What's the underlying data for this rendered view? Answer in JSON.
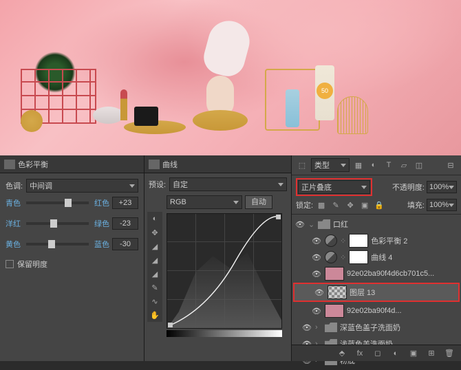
{
  "canvas": {
    "sun_label": "50"
  },
  "colorBalance": {
    "panelTitle": "色彩平衡",
    "toneLabel": "色调:",
    "toneValue": "中间调",
    "sliders": [
      {
        "left": "青色",
        "right": "红色",
        "value": "+23",
        "pos": 62
      },
      {
        "left": "洋红",
        "right": "绿色",
        "value": "-23",
        "pos": 38
      },
      {
        "left": "黄色",
        "right": "蓝色",
        "value": "-30",
        "pos": 35
      }
    ],
    "preserve": "保留明度"
  },
  "curves": {
    "panelTitle": "曲线",
    "presetLabel": "预设:",
    "presetValue": "自定",
    "channel": "RGB",
    "autoBtn": "自动"
  },
  "layers": {
    "kindLabel": "类型",
    "blendMode": "正片叠底",
    "opacityLabel": "不透明度:",
    "opacityValue": "100%",
    "lockLabel": "锁定:",
    "fillLabel": "填充:",
    "fillValue": "100%",
    "group": "口红",
    "items": [
      {
        "name": "色彩平衡 2",
        "type": "adj"
      },
      {
        "name": "曲线 4",
        "type": "adj"
      },
      {
        "name": "92e02ba90f4d6cb701c5...",
        "type": "img"
      },
      {
        "name": "图层 13",
        "type": "layer",
        "selected": true
      },
      {
        "name": "92e02ba90f4d...",
        "type": "img"
      }
    ],
    "groups": [
      {
        "name": "深蓝色盖子洗面奶"
      },
      {
        "name": "浅蓝色盖洗面奶"
      },
      {
        "name": "粉底"
      }
    ]
  }
}
